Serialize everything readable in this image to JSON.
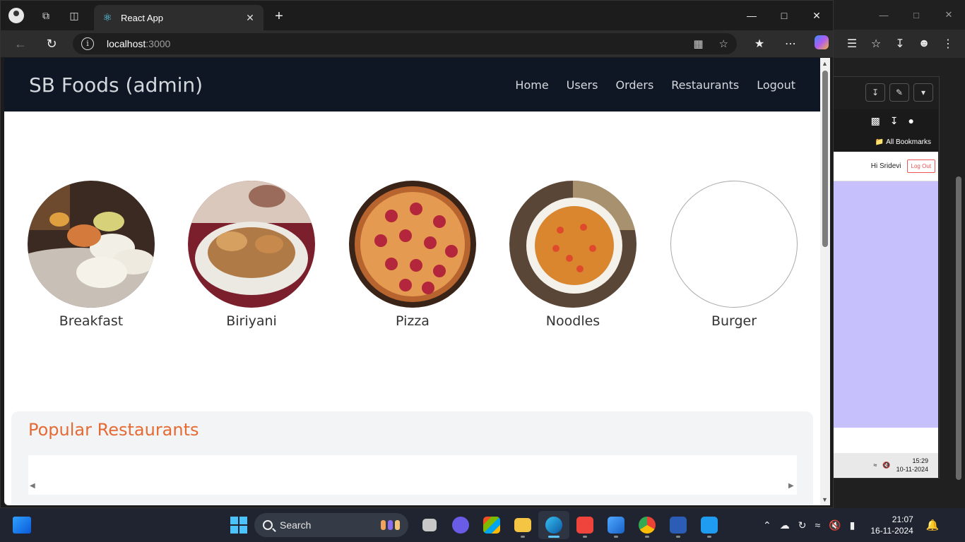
{
  "browser": {
    "tab_title": "React App",
    "address_host": "localhost",
    "address_port": ":3000"
  },
  "app": {
    "brand": "SB Foods (admin)",
    "nav": [
      "Home",
      "Users",
      "Orders",
      "Restaurants",
      "Logout"
    ]
  },
  "categories": [
    {
      "name": "Breakfast",
      "icon": "idli-plate-image"
    },
    {
      "name": "Biriyani",
      "icon": "biriyani-bowl-image"
    },
    {
      "name": "Pizza",
      "icon": "pepperoni-pizza-image"
    },
    {
      "name": "Noodles",
      "icon": "noodles-bowl-image"
    },
    {
      "name": "Burger",
      "icon": "empty-image"
    }
  ],
  "popular": {
    "heading": "Popular Restaurants"
  },
  "background_window": {
    "bookmarks": "All Bookmarks",
    "greeting": "Hi Sridevi",
    "logout": "Log Out",
    "time": "15:29",
    "date": "10-11-2024"
  },
  "taskbar": {
    "search_label": "Search",
    "time": "21:07",
    "date": "16-11-2024"
  },
  "colors": {
    "navbar_bg": "#0f1725",
    "heading_accent": "#e56b34",
    "popular_bg": "#f3f4f6"
  }
}
